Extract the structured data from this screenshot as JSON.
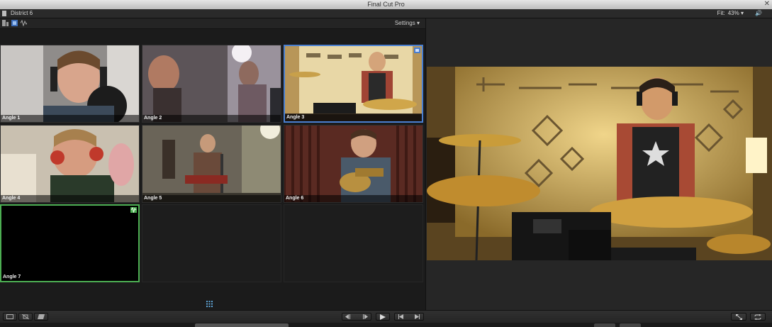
{
  "window": {
    "title": "Final Cut Pro"
  },
  "viewer_header": {
    "project": "District 6",
    "fit_label": "Fit:",
    "fit_value": "43%"
  },
  "angle_toolbar": {
    "settings_label": "Settings"
  },
  "angles": [
    {
      "label": "Angle 1"
    },
    {
      "label": "Angle 2"
    },
    {
      "label": "Angle 3"
    },
    {
      "label": "Angle 4"
    },
    {
      "label": "Angle 5"
    },
    {
      "label": "Angle 6"
    },
    {
      "label": "Angle 7"
    }
  ],
  "colors": {
    "video_switch": "#4a7fd0",
    "audio_switch": "#4cae52",
    "panel_bg": "#1e1e1e"
  },
  "icons": [
    "close-icon",
    "document-icon",
    "video-audio-switch-icon",
    "video-switch-icon",
    "audio-switch-icon",
    "grid-icon",
    "play-icon",
    "previous-edit-icon",
    "next-edit-icon",
    "fullscreen-icon",
    "loop-icon"
  ]
}
